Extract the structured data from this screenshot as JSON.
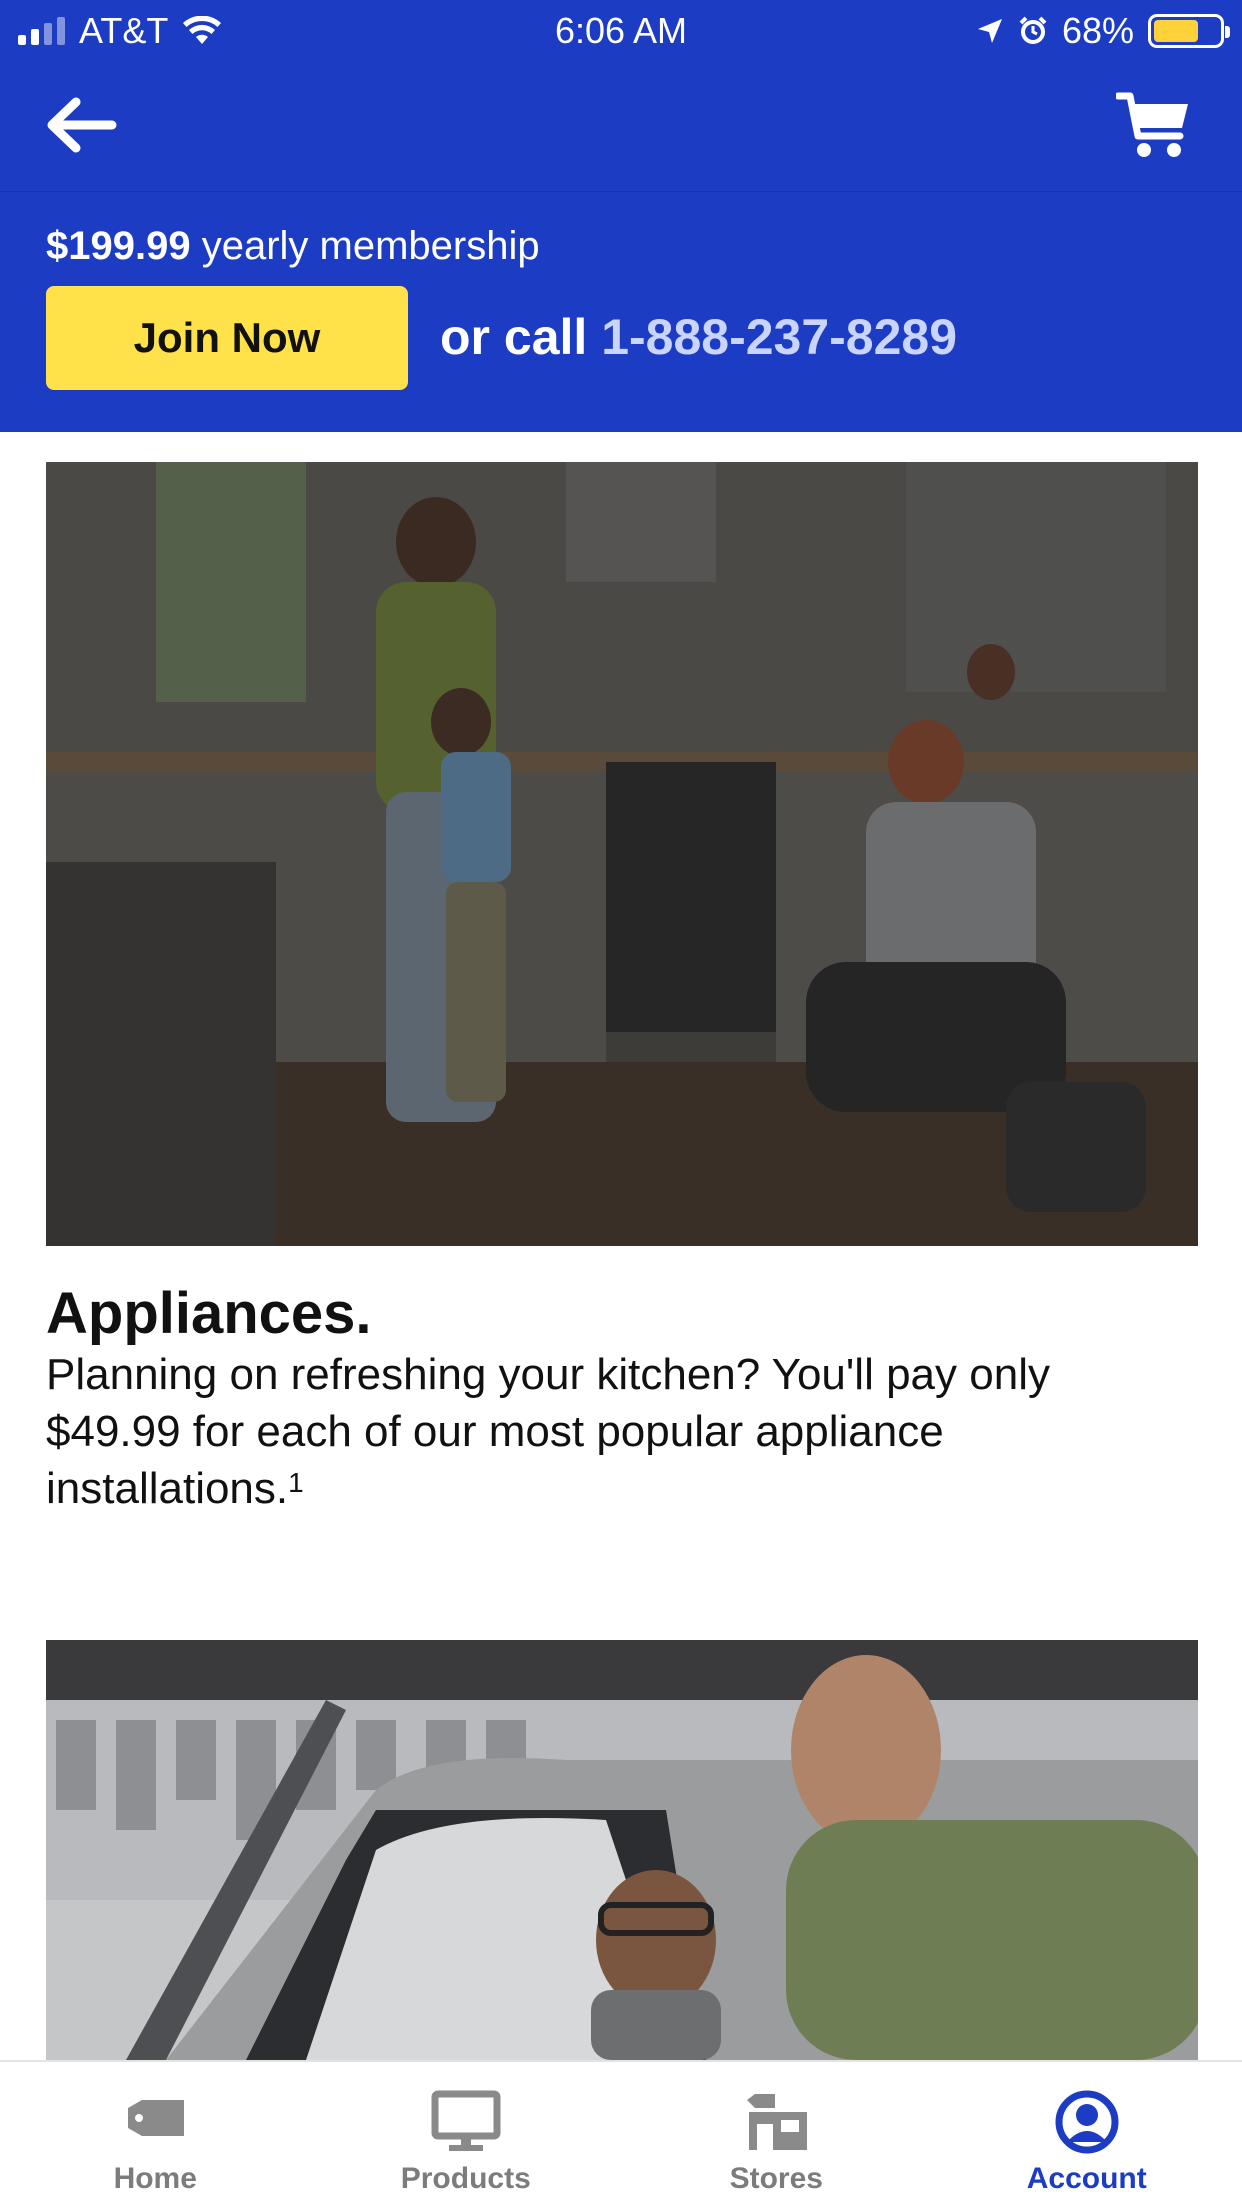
{
  "status_bar": {
    "carrier": "AT&T",
    "time": "6:06 AM",
    "battery": "68%",
    "battery_level": 0.68,
    "icons": [
      "signal-icon",
      "wifi-icon",
      "location-arrow-icon",
      "alarm-icon",
      "battery-icon"
    ]
  },
  "nav": {
    "back_icon": "arrow-left-icon",
    "cart_icon": "shopping-cart-icon"
  },
  "banner": {
    "price": "$199.99",
    "price_suffix": " yearly membership",
    "join_label": "Join Now",
    "call_prefix": "or call ",
    "phone": "1-888-237-8289"
  },
  "appliances": {
    "title": "Appliances.",
    "body": "Planning on refreshing your kitchen? You'll pay only $49.99 for each of our most popular appliance installations.",
    "footnote": "1"
  },
  "tabs": [
    {
      "label": "Home",
      "icon": "tag-icon",
      "active": false
    },
    {
      "label": "Products",
      "icon": "monitor-icon",
      "active": false
    },
    {
      "label": "Stores",
      "icon": "store-icon",
      "active": false
    },
    {
      "label": "Account",
      "icon": "account-circle-icon",
      "active": true
    }
  ],
  "colors": {
    "brand_blue": "#1d3cc4",
    "join_yellow": "#ffe14a",
    "phone_tint": "#c9d4ff",
    "tab_inactive": "#7c7c7c"
  }
}
